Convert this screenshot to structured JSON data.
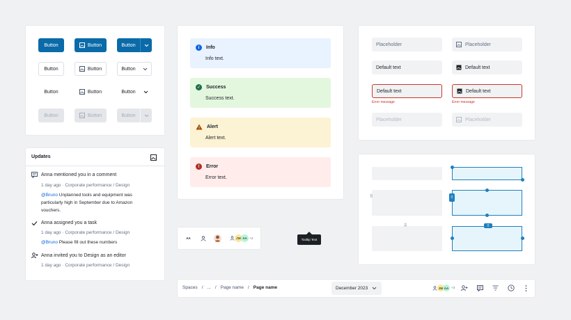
{
  "buttons": {
    "label": "Button"
  },
  "alerts": [
    {
      "title": "Info",
      "body": "Info text.",
      "bg": "#e9f2ff",
      "icon_color": "#0c66e4",
      "glyph": "i",
      "icon": "info-icon"
    },
    {
      "title": "Success",
      "body": "Success text.",
      "bg": "#dcfff1",
      "icon_color": "#216e4e",
      "glyph": "✓",
      "icon": "success-icon"
    },
    {
      "title": "Alert",
      "body": "Alert text.",
      "bg": "#fff7d6",
      "icon_color": "#a54800",
      "glyph": "!",
      "icon": "warning-icon"
    },
    {
      "title": "Error",
      "body": "Error text.",
      "bg": "#ffeceb",
      "icon_color": "#ae2e24",
      "glyph": "!",
      "icon": "error-icon"
    }
  ],
  "fields": {
    "placeholder": "Placeholder",
    "default": "Default text",
    "error_message": "Error message"
  },
  "updates": {
    "title": "Updates",
    "items": [
      {
        "icon": "comment-icon",
        "text": "Anna mentioned you in a comment",
        "meta": "1 day ago · Corporate performance / Design",
        "mention": "@Bruno",
        "detail": " Unplanned tools and equipment was particularly high in September due to Amazon vouchers."
      },
      {
        "icon": "check-icon",
        "text": "Anna assigned you a task",
        "meta": "1 day ago · Corporate performance / Design",
        "mention": "@Bruno",
        "detail": " Please fill out these numbers"
      },
      {
        "icon": "add-person-icon",
        "text": "Anna invited you to Design as an editor",
        "meta": "1 day ago · Corporate performance / Design"
      }
    ]
  },
  "avatars": {
    "initials_aa": "AA",
    "initials_jw": "JW",
    "initials_aa2": "AA",
    "more": "+3"
  },
  "tooltip": {
    "text": "Tooltip Text"
  },
  "breadcrumb": {
    "items": [
      "Spaces",
      "/",
      "...",
      "/",
      "Page name",
      "/",
      "Page name"
    ],
    "date": "December 2023",
    "avatars": {
      "jw": "JW",
      "aa": "AA",
      "more": "+3"
    }
  },
  "colors": {
    "primary": "#0b6aa8",
    "error": "#c9372c",
    "selection": "#1f7fbd"
  }
}
